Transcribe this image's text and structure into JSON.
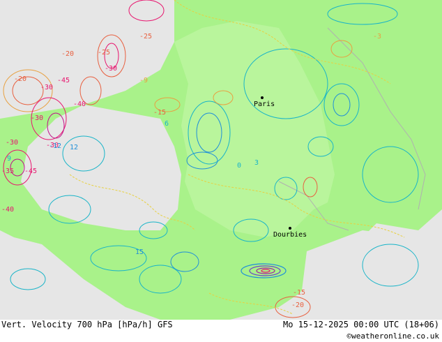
{
  "map": {
    "cities": [
      {
        "name": "Paris"
      },
      {
        "name": "Dourbies"
      }
    ],
    "contour_labels": [
      "-25",
      "-20",
      "-30",
      "-25",
      "-30",
      "-45",
      "-20",
      "-30",
      "-40",
      "-30",
      "-40",
      "-30",
      "-35",
      "-45",
      "-12",
      "-15",
      "-9",
      "-3",
      "0",
      "3",
      "6",
      "9",
      "12",
      "15",
      "-15",
      "-20"
    ],
    "colors": {
      "land_green": "#a9f28a",
      "land_light": "#c4f7a8",
      "sea_grey": "#e6e6e6",
      "positive_line": "#18b4c8",
      "negative_line": "#e8a040",
      "strong_negative": "#e8146e"
    }
  },
  "footer": {
    "title": "Vert. Velocity 700 hPa [hPa/h] GFS",
    "datetime": "Mo 15-12-2025 00:00 UTC (18+06)",
    "credit": "©weatheronline.co.uk"
  }
}
